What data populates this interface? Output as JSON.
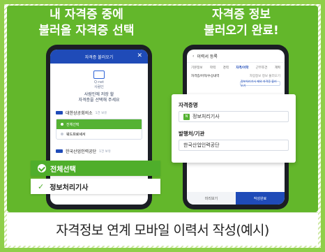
{
  "headings": {
    "left_line1": "내 자격증 중에",
    "left_line2": "불러올 자격증 선택",
    "right_line1": "자격증 정보",
    "right_line2": "불러오기 완료!"
  },
  "phone1": {
    "title": "자격증 불러오기",
    "brand_small_1": "Q-net",
    "brand_small_2": "사람인",
    "prompt_1": "사람인에 저장 할",
    "prompt_highlight": "사람인",
    "prompt_2": "자격증을 선택해 주세요",
    "org_1": "대한상공회의소",
    "org_1_sub": "1건 보유",
    "option_on": "전체선택",
    "option_off": "워드프로세서",
    "org_2": "한국산업인력공단",
    "org_2_sub": "1건 보유",
    "overlay_selected": "전체선택",
    "overlay_item": "정보처리기사"
  },
  "phone2": {
    "title": "이력서 등록",
    "tabs": [
      "기본정보",
      "학력",
      "경력",
      "자격/어학",
      "근무조건",
      "계획"
    ],
    "active_tab_index": 3,
    "row_label": "자격증/어학/수상내역",
    "row_right": "자업정보 정보 불러오기",
    "chip": "정보처리기사 제외 자격증 불러오기",
    "card_label_1": "자격증명",
    "card_value_1": "정보처리기사",
    "card_label_2": "발행처/기관",
    "card_value_2": "한국산업인력공단",
    "footer_left": "미리보기",
    "footer_right": "작성완료"
  },
  "caption": "자격정보 연계 모바일 이력서 작성(예시)",
  "colors": {
    "accent_green": "#4fae2b",
    "brand_blue": "#1f4bb8",
    "panel_green": "#63b72b"
  }
}
